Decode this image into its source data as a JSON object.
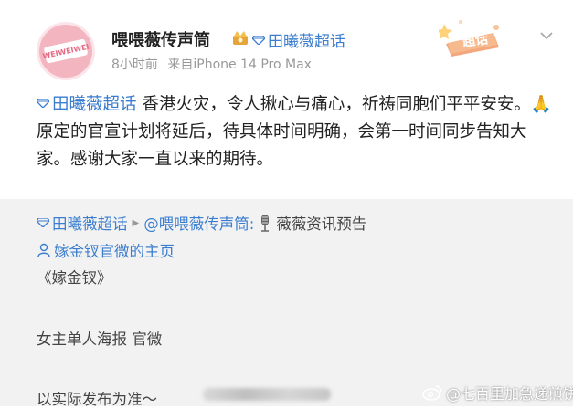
{
  "post": {
    "username": "喂喂薇传声筒",
    "topic_tag": "田曦薇超话",
    "time": "8小时前",
    "source": "来自iPhone 14 Pro Max",
    "badge_label": "超话",
    "avatar_text": "WEIWEIWEI",
    "body_tag": "田曦薇超话",
    "body_text": " 香港火灾，令人揪心与痛心，祈祷同胞们平平安安。🙏 原定的官宣计划将延后，待具体时间明确，会第一时间同步告知大家。感谢大家一直以来的期待。"
  },
  "repost": {
    "topic_tag": "田曦薇超话",
    "author": "@喂喂薇传声筒:",
    "category": "薇薇资讯预告",
    "homepage_link": "嫁金钗官微的主页",
    "title": "《嫁金钗》",
    "line_poster": "女主单人海报 官微",
    "line_note": "以实际发布为准～"
  },
  "watermark": "@七百里加急递煎饼",
  "colors": {
    "link_blue": "#3b7ecf",
    "repost_bg": "#f2f2f2",
    "avatar_pink": "#f3b6c0"
  }
}
